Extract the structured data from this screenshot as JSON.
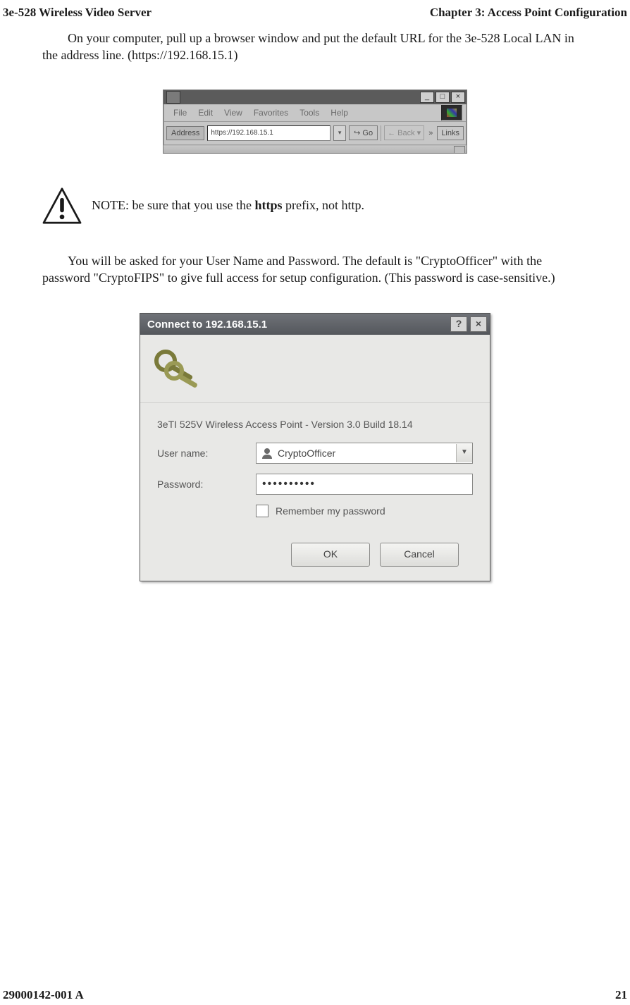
{
  "header": {
    "left": "3e-528 Wireless Video Server",
    "right": "Chapter 3: Access Point Configuration"
  },
  "intro": {
    "text_a": "On your computer, pull up a browser window and put the default URL for the 3e-528 Local LAN in the address line. (https://192.168.15.1)"
  },
  "browser": {
    "menu": {
      "file": "File",
      "edit": "Edit",
      "view": "View",
      "favorites": "Favorites",
      "tools": "Tools",
      "help": "Help"
    },
    "address_label": "Address",
    "address_value": "https://192.168.15.1",
    "go_label": "Go",
    "back_label": "Back",
    "links_label": "Links",
    "sys": {
      "min": "_",
      "max": "□",
      "close": "×"
    }
  },
  "note": {
    "prefix": "NOTE: be sure that you use the ",
    "bold": "https",
    "suffix": " prefix, not http."
  },
  "creds": {
    "para": "You will be asked for your User Name and Password. The default  is \"CryptoOfficer\" with the password \"CryptoFIPS\" to give full access for setup configuration. (This password is case-sensitive.)"
  },
  "dialog": {
    "title": "Connect to 192.168.15.1",
    "info": "3eTI 525V Wireless Access Point - Version 3.0 Build 18.14",
    "username_label": "User name:",
    "username_value": "CryptoOfficer",
    "password_label": "Password:",
    "password_mask": "••••••••••",
    "remember_label": "Remember my password",
    "ok_label": "OK",
    "cancel_label": "Cancel",
    "help_btn": "?",
    "close_btn": "×"
  },
  "footer": {
    "left": "29000142-001 A",
    "right": "21"
  }
}
